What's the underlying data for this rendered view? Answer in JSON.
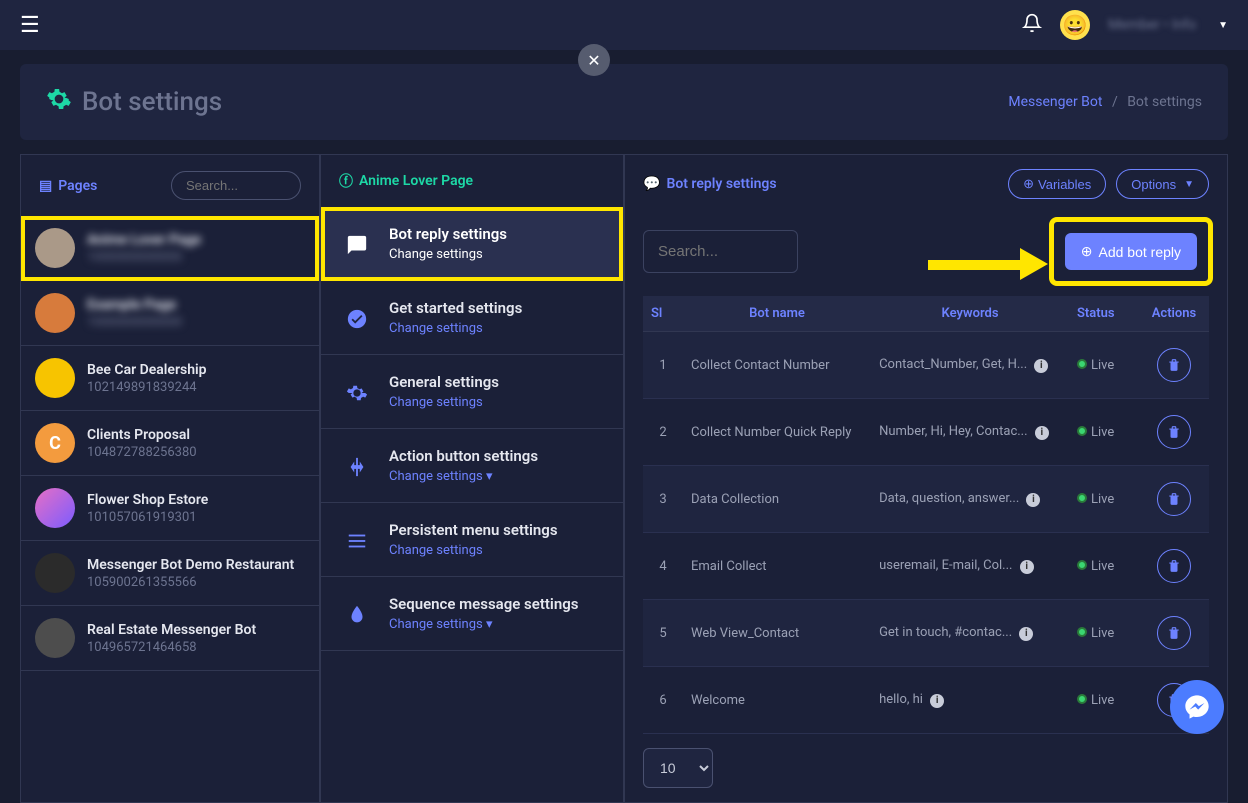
{
  "topbar": {
    "user_name": "Member • Info"
  },
  "header": {
    "title": "Bot settings",
    "breadcrumb_parent": "Messenger Bot",
    "breadcrumb_current": "Bot settings"
  },
  "pages_panel": {
    "title": "Pages",
    "search_placeholder": "Search...",
    "items": [
      {
        "name": "Anime Lover Page",
        "sub": "1000000000000",
        "blurred": true,
        "highlighted": true,
        "avatar_bg": "#a98",
        "avatar_letter": ""
      },
      {
        "name": "Example Page",
        "sub": "1000000000000",
        "blurred": true,
        "highlighted": false,
        "avatar_bg": "#d77b3c",
        "avatar_letter": ""
      },
      {
        "name": "Bee Car Dealership",
        "sub": "102149891839244",
        "blurred": false,
        "avatar_bg": "#f7c400",
        "avatar_letter": ""
      },
      {
        "name": "Clients Proposal",
        "sub": "104872788256380",
        "blurred": false,
        "avatar_bg": "#f39b3e",
        "avatar_letter": "C"
      },
      {
        "name": "Flower Shop Estore",
        "sub": "101057061919301",
        "blurred": false,
        "avatar_bg": "linear-gradient(135deg,#e66fc5,#7b5cff)",
        "avatar_letter": ""
      },
      {
        "name": "Messenger Bot Demo Restaurant",
        "sub": "105900261355566",
        "blurred": false,
        "avatar_bg": "#2b2b2b",
        "avatar_letter": ""
      },
      {
        "name": "Real Estate Messenger Bot",
        "sub": "104965721464658",
        "blurred": false,
        "avatar_bg": "#4d4d4d",
        "avatar_letter": ""
      }
    ]
  },
  "settings_panel": {
    "title": "Anime Lover Page",
    "items": [
      {
        "title": "Bot reply settings",
        "sub": "Change settings",
        "icon": "chat",
        "highlighted": true
      },
      {
        "title": "Get started settings",
        "sub": "Change settings",
        "icon": "check"
      },
      {
        "title": "General settings",
        "sub": "Change settings",
        "icon": "gear"
      },
      {
        "title": "Action button settings",
        "sub": "Change settings ▾",
        "icon": "pointer"
      },
      {
        "title": "Persistent menu settings",
        "sub": "Change settings",
        "icon": "menu"
      },
      {
        "title": "Sequence message settings",
        "sub": "Change settings ▾",
        "icon": "drop"
      }
    ]
  },
  "reply_panel": {
    "title": "Bot reply settings",
    "variables_btn": "Variables",
    "options_btn": "Options",
    "search_placeholder": "Search...",
    "add_btn": "Add bot reply",
    "columns": {
      "sl": "Sl",
      "name": "Bot name",
      "keywords": "Keywords",
      "status": "Status",
      "actions": "Actions"
    },
    "rows": [
      {
        "sl": "1",
        "name": "Collect Contact Number",
        "keywords": "Contact_Number, Get, H...",
        "status": "Live"
      },
      {
        "sl": "2",
        "name": "Collect Number Quick Reply",
        "keywords": "Number, Hi, Hey, Contac...",
        "status": "Live"
      },
      {
        "sl": "3",
        "name": "Data Collection",
        "keywords": "Data, question, answer...",
        "status": "Live"
      },
      {
        "sl": "4",
        "name": "Email Collect",
        "keywords": "useremail, E-mail, Col...",
        "status": "Live"
      },
      {
        "sl": "5",
        "name": "Web View_Contact",
        "keywords": "Get in touch, #contac...",
        "status": "Live"
      },
      {
        "sl": "6",
        "name": "Welcome",
        "keywords": "hello, hi",
        "status": "Live"
      }
    ],
    "page_size": "10"
  }
}
